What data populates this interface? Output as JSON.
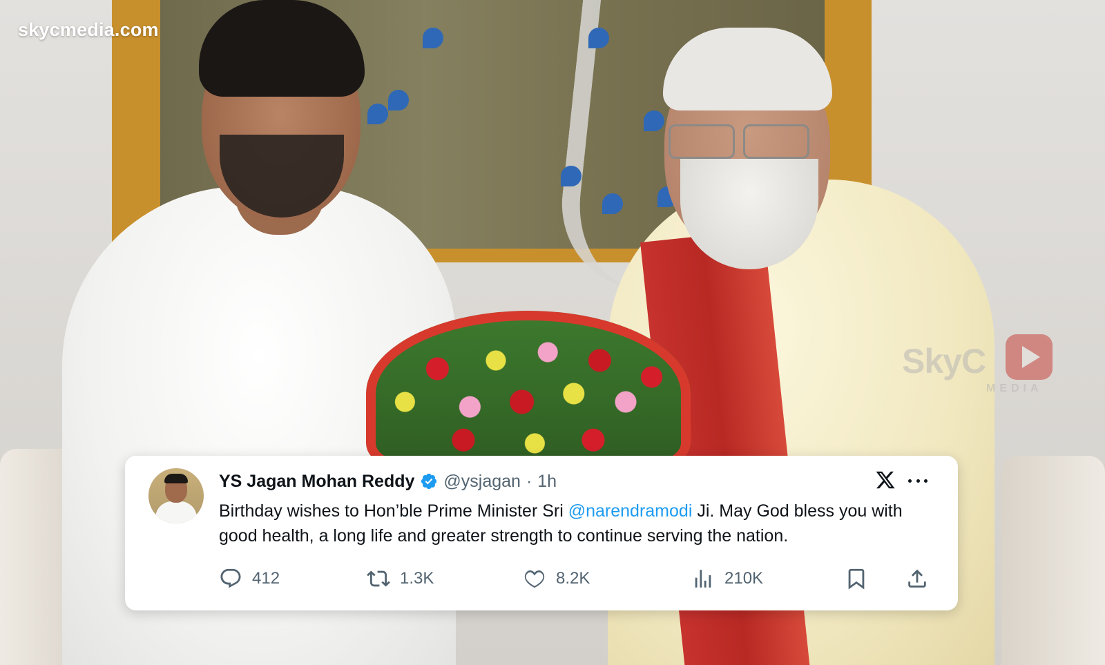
{
  "watermark": {
    "site": "skycmedia.com",
    "brand_main": "SkyC",
    "brand_sub": "MEDIA"
  },
  "tweet": {
    "display_name": "YS Jagan Mohan Reddy",
    "handle": "@ysjagan",
    "separator": "·",
    "time": "1h",
    "text_before": "Birthday wishes to Hon’ble Prime Minister Sri ",
    "mention": "@narendramodi",
    "text_after": " Ji. May God bless you with good health, a long life and greater strength to continue serving the nation.",
    "colors": {
      "mention": "#1d9bf0",
      "verified": "#1d9bf0",
      "muted": "#536471",
      "text": "#0f1419"
    },
    "icons": {
      "verified": "verified-badge-icon",
      "platform": "x-logo-icon",
      "more": "more-options-icon"
    },
    "stats": {
      "replies": "412",
      "reposts": "1.3K",
      "likes": "8.2K",
      "views": "210K"
    }
  }
}
